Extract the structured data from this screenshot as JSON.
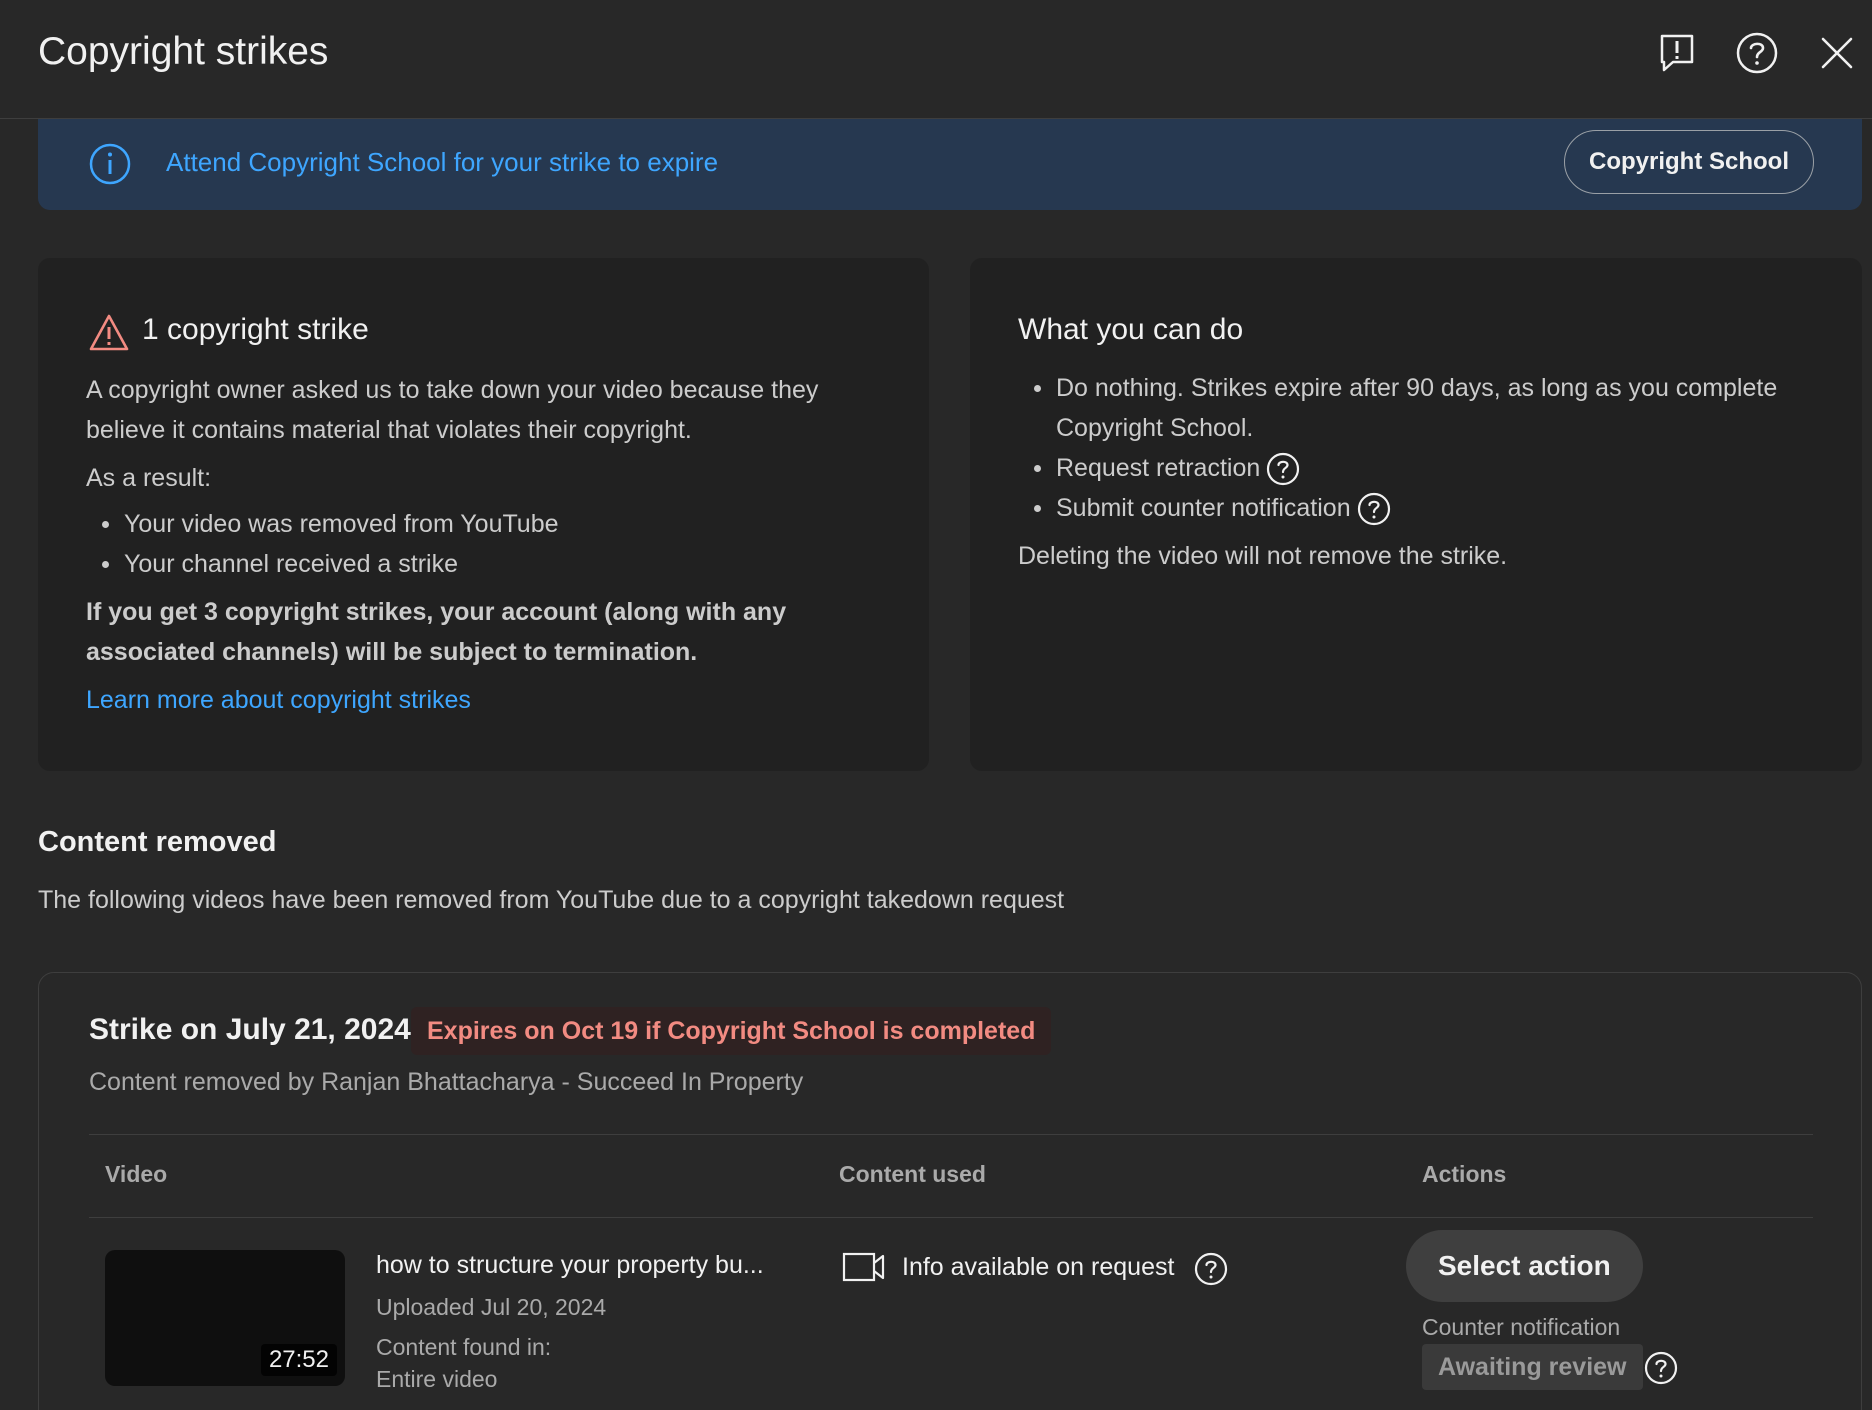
{
  "header": {
    "title": "Copyright strikes",
    "icons": [
      "feedback-icon",
      "help-icon",
      "close-icon"
    ]
  },
  "banner": {
    "message": "Attend Copyright School for your strike to expire",
    "button_label": "Copyright School"
  },
  "strike_card": {
    "heading": "1 copyright strike",
    "description": "A copyright owner asked us to take down your video because they believe it contains material that violates their copyright.",
    "as_result": "As a result:",
    "bullets": [
      "Your video was removed from YouTube",
      "Your channel received a strike"
    ],
    "warning": "If you get 3 copyright strikes, your account (along with any associated channels) will be subject to termination.",
    "learn_more": "Learn more about copyright strikes"
  },
  "actions_card": {
    "heading": "What you can do",
    "bullets": [
      "Do nothing. Strikes expire after 90 days, as long as you complete Copyright School.",
      "Request retraction",
      "Submit counter notification"
    ],
    "note": "Deleting the video will not remove the strike."
  },
  "content_removed": {
    "title": "Content removed",
    "description": "The following videos have been removed from YouTube due to a copyright takedown request"
  },
  "strike": {
    "title": "Strike on July 21, 2024",
    "expires": "Expires on Oct 19 if Copyright School is completed",
    "removed_by": "Content removed by Ranjan Bhattacharya - Succeed In Property",
    "columns": [
      "Video",
      "Content used",
      "Actions"
    ],
    "row": {
      "duration": "27:52",
      "video_title": "how to structure your property bu...",
      "uploaded": "Uploaded Jul 20, 2024",
      "found_in_label": "Content found in:",
      "found_in_value": "Entire video",
      "content_used": "Info available on request",
      "action_button": "Select action",
      "counter_label": "Counter notification",
      "counter_status": "Awaiting review"
    }
  },
  "colors": {
    "background": "#282828",
    "card": "#212121",
    "banner": "#263850",
    "link": "#3ea6ff",
    "danger": "#f28b82"
  }
}
